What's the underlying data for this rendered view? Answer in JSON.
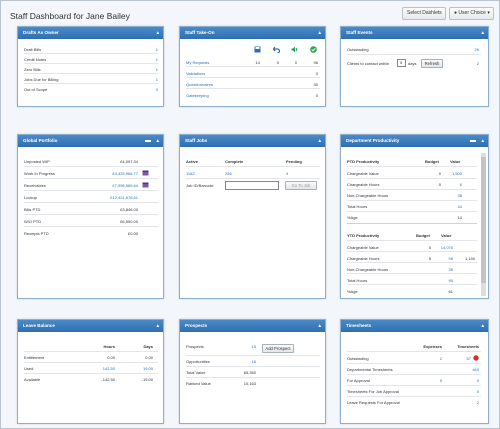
{
  "page_title": "Staff Dashboard for Jane Bailey",
  "top": {
    "select_dashlets": "Select Dashlets",
    "user_choice": "User Choice"
  },
  "drafts": {
    "title": "Drafts As Owner",
    "rows": [
      [
        "Draft Bills",
        "1"
      ],
      [
        "Credit Notes",
        "1"
      ],
      [
        "Zero Bills",
        "1"
      ],
      [
        "Jobs Due for Billing",
        "1"
      ],
      [
        "Out of Scope",
        "0"
      ]
    ]
  },
  "takeon": {
    "title": "Staff Take-On",
    "rows": [
      [
        "My Requests",
        "14",
        "0",
        "0",
        "96"
      ],
      [
        "Validations",
        "",
        "",
        "",
        "0"
      ],
      [
        "Questionnaires",
        "",
        "",
        "",
        "30"
      ],
      [
        "Gatekeeping",
        "",
        "",
        "",
        "0"
      ]
    ]
  },
  "events": {
    "title": "Staff Events",
    "outstanding_label": "Outstanding",
    "outstanding_value": "29",
    "clients_label": "Clients to contact within",
    "days_value": "5",
    "days_label": "days",
    "refresh": "Refresh",
    "clients_value": "2"
  },
  "portfolio": {
    "title": "Global Portfolio",
    "rows": [
      [
        "Unposted WIP",
        "£4,097.34"
      ],
      [
        "Work In Progress",
        "£4,425,966.77"
      ],
      [
        "Receivables",
        "£7,995,589.64"
      ],
      [
        "Lockup",
        "£12,421,676.61"
      ],
      [
        "Bills PTD",
        "£3,846.00"
      ],
      [
        "W/O PTD",
        "£6,550.00"
      ],
      [
        "Receipts PTD",
        "£0.00"
      ]
    ]
  },
  "jobs": {
    "title": "Staff Jobs",
    "headers": [
      "Active",
      "Complete",
      "Pending"
    ],
    "values": [
      "1162",
      "256",
      "4"
    ],
    "search_label": "Job ID/Barcode",
    "search_value": "",
    "go": "Go To Job"
  },
  "dept": {
    "title": "Department Productivity",
    "ptd": {
      "headers": [
        "PTD Productivity",
        "Budget",
        "Value"
      ],
      "rows": [
        [
          "Chargeable Value",
          "0",
          "1,500"
        ],
        [
          "Chargeable Hours",
          "0",
          "6"
        ],
        [
          "Non-Chargeable Hours",
          "",
          "38"
        ],
        [
          "Total Hours",
          "",
          "44"
        ],
        [
          "%Age",
          "",
          "14"
        ]
      ]
    },
    "ytd": {
      "headers": [
        "YTD Productivity",
        "Budget",
        "Value"
      ],
      "rows": [
        [
          "Chargeable Value",
          "5",
          "14,070",
          ""
        ],
        [
          "Chargeable Hours",
          "5",
          "95",
          "1,190"
        ],
        [
          "Non-Chargeable Hours",
          "",
          "35",
          ""
        ],
        [
          "Total Hours",
          "",
          "90",
          ""
        ],
        [
          "%Age",
          "",
          "61",
          ""
        ]
      ]
    }
  },
  "leave": {
    "title": "Leave Balance",
    "headers": [
      "Hours",
      "Days"
    ],
    "rows": [
      [
        "Entitlement",
        "0.00",
        "0.00"
      ],
      [
        "Used",
        "142.50",
        "19.00"
      ],
      [
        "Available",
        "-142.50",
        "-19.00"
      ]
    ]
  },
  "prospects": {
    "title": "Prospects",
    "rows": [
      [
        "Prospects",
        "15"
      ],
      [
        "Opportunities",
        "16"
      ],
      [
        "Total Value",
        "65,350"
      ],
      [
        "Ranked Value",
        "10,163"
      ]
    ],
    "add": "Add Prospect"
  },
  "timesheets": {
    "title": "Timesheets",
    "headers": [
      "Expenses",
      "Timesheets"
    ],
    "rows": [
      [
        "Outstanding",
        "2",
        "57"
      ],
      [
        "Departmental Timesheets",
        "",
        "463"
      ],
      [
        "For Approval",
        "5",
        "0"
      ],
      [
        "Timesheets For Job Approval",
        "",
        "0"
      ],
      [
        "Leave Requests For Approval",
        "",
        "2"
      ]
    ]
  },
  "colors": {
    "header": "#2f6fb0",
    "link": "#2a6fb4",
    "alert": "#d9302a",
    "save": "#2a6fb4",
    "undo": "#2a6fb4",
    "sound": "#27a060",
    "ok": "#2ea44f"
  }
}
